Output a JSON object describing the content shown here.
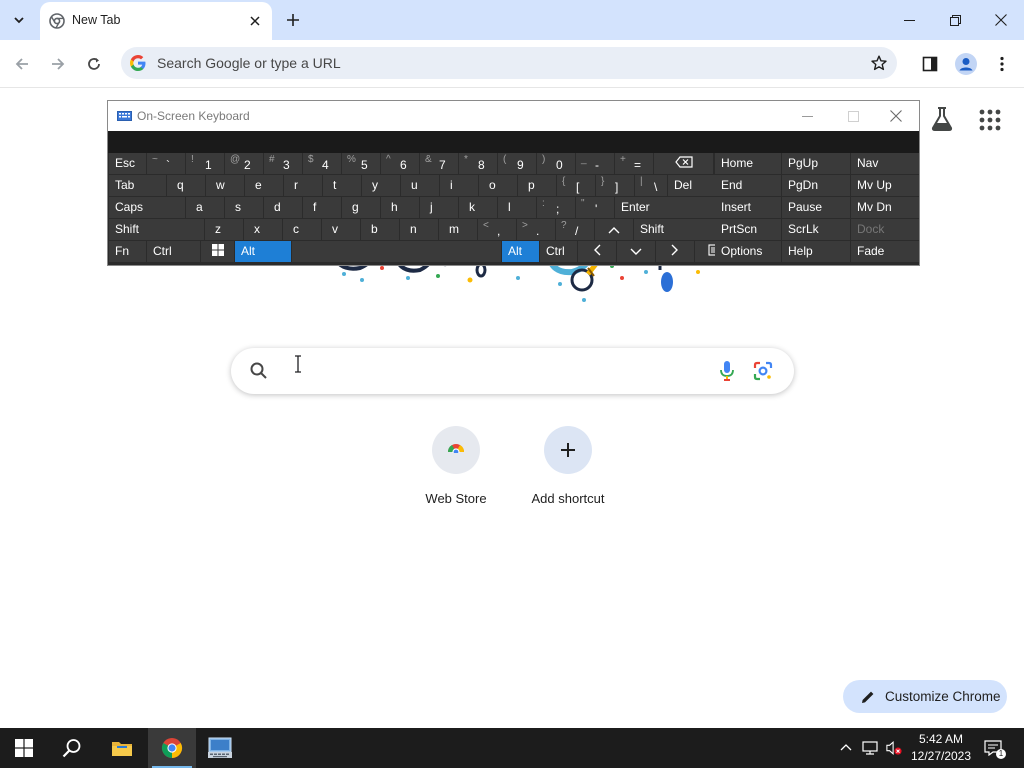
{
  "browser": {
    "tab": {
      "title": "New Tab"
    },
    "omnibox": {
      "placeholder": "Search Google or type a URL"
    }
  },
  "ntp": {
    "search_placeholder": "",
    "shortcuts": [
      {
        "label": "Web Store",
        "icon": "webstore-icon"
      },
      {
        "label": "Add shortcut",
        "icon": "plus-icon"
      }
    ],
    "customize_label": "Customize Chrome"
  },
  "osk": {
    "title": "On-Screen Keyboard",
    "rows": [
      [
        {
          "label": "Esc"
        },
        {
          "shift": "~",
          "main": "`"
        },
        {
          "shift": "!",
          "main": "1"
        },
        {
          "shift": "@",
          "main": "2"
        },
        {
          "shift": "#",
          "main": "3"
        },
        {
          "shift": "$",
          "main": "4"
        },
        {
          "shift": "%",
          "main": "5"
        },
        {
          "shift": "^",
          "main": "6"
        },
        {
          "shift": "&",
          "main": "7"
        },
        {
          "shift": "*",
          "main": "8"
        },
        {
          "shift": "(",
          "main": "9"
        },
        {
          "shift": ")",
          "main": "0"
        },
        {
          "shift": "_",
          "main": "-"
        },
        {
          "shift": "+",
          "main": "="
        },
        {
          "label": "",
          "icon": "backspace-icon"
        }
      ],
      [
        {
          "label": "Tab"
        },
        {
          "label": "q"
        },
        {
          "label": "w"
        },
        {
          "label": "e"
        },
        {
          "label": "r"
        },
        {
          "label": "t"
        },
        {
          "label": "y"
        },
        {
          "label": "u"
        },
        {
          "label": "i"
        },
        {
          "label": "o"
        },
        {
          "label": "p"
        },
        {
          "shift": "{",
          "main": "["
        },
        {
          "shift": "}",
          "main": "]"
        },
        {
          "shift": "|",
          "main": "\\"
        },
        {
          "label": "Del"
        }
      ],
      [
        {
          "label": "Caps"
        },
        {
          "label": "a"
        },
        {
          "label": "s"
        },
        {
          "label": "d"
        },
        {
          "label": "f"
        },
        {
          "label": "g"
        },
        {
          "label": "h"
        },
        {
          "label": "j"
        },
        {
          "label": "k"
        },
        {
          "label": "l"
        },
        {
          "shift": ":",
          "main": ";"
        },
        {
          "shift": "\"",
          "main": "'"
        },
        {
          "label": "Enter"
        }
      ],
      [
        {
          "label": "Shift"
        },
        {
          "label": "z"
        },
        {
          "label": "x"
        },
        {
          "label": "c"
        },
        {
          "label": "v"
        },
        {
          "label": "b"
        },
        {
          "label": "n"
        },
        {
          "label": "m"
        },
        {
          "shift": "<",
          "main": ","
        },
        {
          "shift": ">",
          "main": "."
        },
        {
          "shift": "?",
          "main": "/"
        },
        {
          "label": "",
          "icon": "up-arrow-icon"
        },
        {
          "label": "Shift"
        }
      ],
      [
        {
          "label": "Fn"
        },
        {
          "label": "Ctrl"
        },
        {
          "label": "",
          "icon": "windows-logo-icon"
        },
        {
          "label": "Alt",
          "active": true
        },
        {
          "label": ""
        },
        {
          "label": "Alt",
          "active": true
        },
        {
          "label": "Ctrl"
        },
        {
          "label": "",
          "icon": "left-arrow-icon"
        },
        {
          "label": "",
          "icon": "down-arrow-icon"
        },
        {
          "label": "",
          "icon": "right-arrow-icon"
        },
        {
          "label": "",
          "icon": "context-menu-icon"
        }
      ]
    ],
    "nav_rows": [
      [
        {
          "label": "Home"
        },
        {
          "label": "PgUp"
        },
        {
          "label": "Nav"
        }
      ],
      [
        {
          "label": "End"
        },
        {
          "label": "PgDn"
        },
        {
          "label": "Mv Up"
        }
      ],
      [
        {
          "label": "Insert"
        },
        {
          "label": "Pause"
        },
        {
          "label": "Mv Dn"
        }
      ],
      [
        {
          "label": "PrtScn"
        },
        {
          "label": "ScrLk"
        },
        {
          "label": "Dock",
          "disabled": true
        }
      ],
      [
        {
          "label": "Options"
        },
        {
          "label": "Help"
        },
        {
          "label": "Fade"
        }
      ]
    ]
  },
  "taskbar": {
    "time": "5:42 AM",
    "date": "12/27/2023"
  },
  "colors": {
    "accent": "#1e7fd6",
    "chrome_frame": "#d3e3fd",
    "osk_key": "#3a3a3a"
  }
}
